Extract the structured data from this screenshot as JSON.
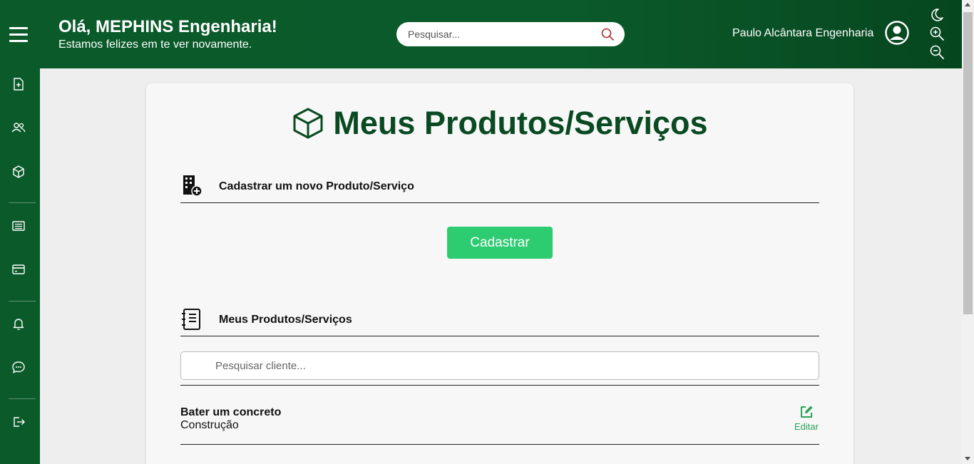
{
  "header": {
    "greeting_title": "Olá, MEPHINS Engenharia!",
    "greeting_subtitle": "Estamos felizes em te ver novamente.",
    "search_placeholder": "Pesquisar...",
    "user_name": "Paulo Alcântara Engenharia",
    "icons": [
      "menu-icon",
      "search-icon",
      "user-avatar-icon",
      "moon-icon",
      "zoom-in-icon",
      "zoom-out-icon"
    ]
  },
  "sidebar": {
    "items": [
      {
        "name": "new-document-icon"
      },
      {
        "name": "users-icon"
      },
      {
        "name": "box-icon"
      },
      {
        "name": "list-icon"
      },
      {
        "name": "credit-card-icon"
      },
      {
        "name": "bell-icon"
      },
      {
        "name": "chat-icon"
      },
      {
        "name": "logout-icon"
      }
    ]
  },
  "main": {
    "title": "Meus Produtos/Serviços",
    "register_section": {
      "label": "Cadastrar um novo Produto/Serviço",
      "button_label": "Cadastrar"
    },
    "list_section": {
      "label": "Meus Produtos/Serviços",
      "search_placeholder": "Pesquisar cliente...",
      "items": [
        {
          "name": "Bater um concreto",
          "category": "Construção",
          "action_label": "Editar"
        }
      ]
    }
  },
  "colors": {
    "header_green": "#0a5a2a",
    "title_green": "#0a4a22",
    "button_green": "#2ecc71",
    "edit_green": "#2aa35a"
  }
}
